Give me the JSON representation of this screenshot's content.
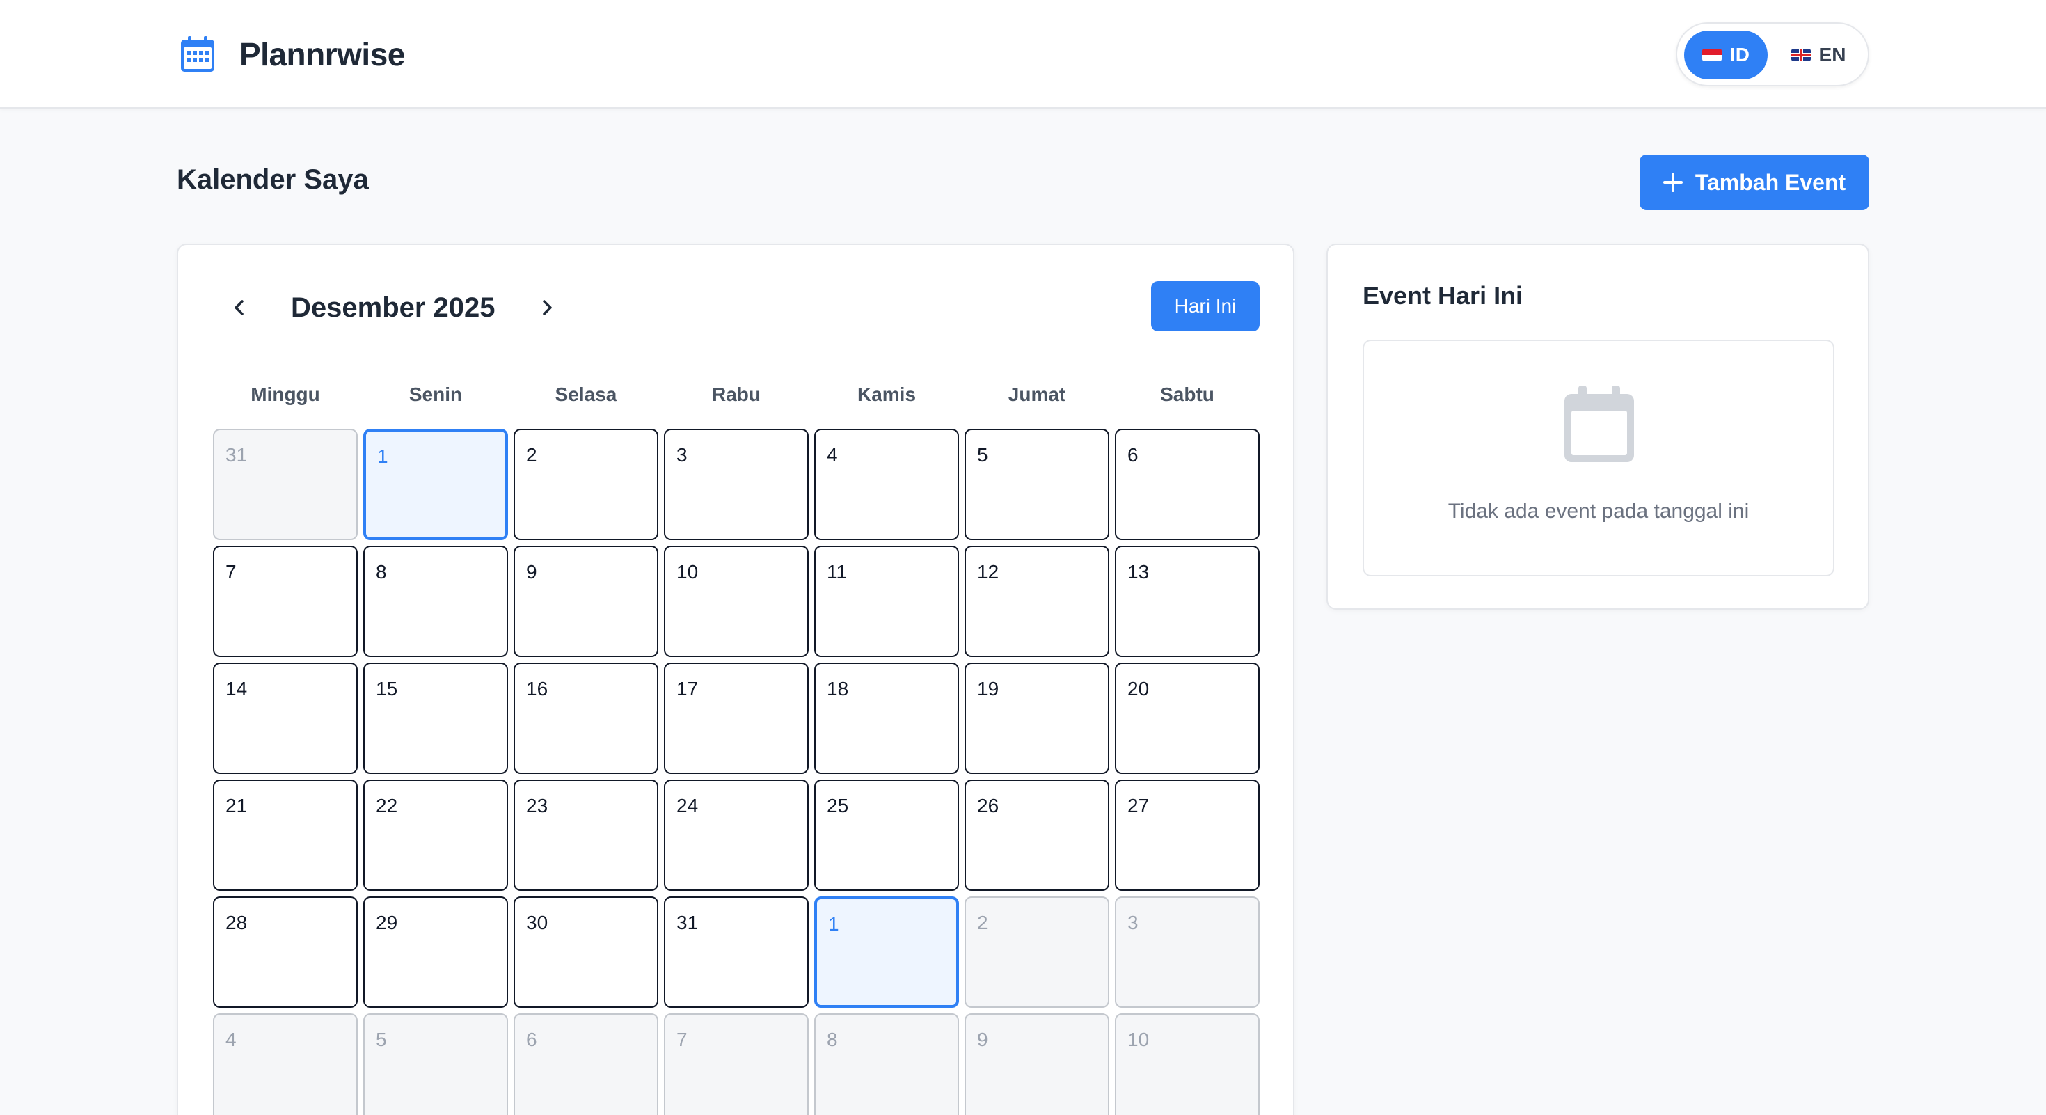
{
  "app": {
    "name": "Plannrwise",
    "brand_color": "#2f80f5"
  },
  "language": {
    "options": [
      {
        "code": "ID",
        "flag": "flag-id-icon",
        "active": true
      },
      {
        "code": "EN",
        "flag": "flag-uk-icon",
        "active": false
      }
    ]
  },
  "page": {
    "title": "Kalender Saya",
    "add_event_label": "Tambah Event"
  },
  "calendar": {
    "month_label": "Desember 2025",
    "today_label": "Hari Ini",
    "weekdays": [
      "Minggu",
      "Senin",
      "Selasa",
      "Rabu",
      "Kamis",
      "Jumat",
      "Sabtu"
    ],
    "days": [
      {
        "label": "31",
        "state": "other"
      },
      {
        "label": "1",
        "state": "selected"
      },
      {
        "label": "2",
        "state": "current"
      },
      {
        "label": "3",
        "state": "current"
      },
      {
        "label": "4",
        "state": "current"
      },
      {
        "label": "5",
        "state": "current"
      },
      {
        "label": "6",
        "state": "current"
      },
      {
        "label": "7",
        "state": "current"
      },
      {
        "label": "8",
        "state": "current"
      },
      {
        "label": "9",
        "state": "current"
      },
      {
        "label": "10",
        "state": "current"
      },
      {
        "label": "11",
        "state": "current"
      },
      {
        "label": "12",
        "state": "current"
      },
      {
        "label": "13",
        "state": "current"
      },
      {
        "label": "14",
        "state": "current"
      },
      {
        "label": "15",
        "state": "current"
      },
      {
        "label": "16",
        "state": "current"
      },
      {
        "label": "17",
        "state": "current"
      },
      {
        "label": "18",
        "state": "current"
      },
      {
        "label": "19",
        "state": "current"
      },
      {
        "label": "20",
        "state": "current"
      },
      {
        "label": "21",
        "state": "current"
      },
      {
        "label": "22",
        "state": "current"
      },
      {
        "label": "23",
        "state": "current"
      },
      {
        "label": "24",
        "state": "current"
      },
      {
        "label": "25",
        "state": "current"
      },
      {
        "label": "26",
        "state": "current"
      },
      {
        "label": "27",
        "state": "current"
      },
      {
        "label": "28",
        "state": "current"
      },
      {
        "label": "29",
        "state": "current"
      },
      {
        "label": "30",
        "state": "current"
      },
      {
        "label": "31",
        "state": "current"
      },
      {
        "label": "1",
        "state": "selected"
      },
      {
        "label": "2",
        "state": "other"
      },
      {
        "label": "3",
        "state": "other"
      },
      {
        "label": "4",
        "state": "other"
      },
      {
        "label": "5",
        "state": "other"
      },
      {
        "label": "6",
        "state": "other"
      },
      {
        "label": "7",
        "state": "other"
      },
      {
        "label": "8",
        "state": "other"
      },
      {
        "label": "9",
        "state": "other"
      },
      {
        "label": "10",
        "state": "other"
      }
    ]
  },
  "events": {
    "title": "Event Hari Ini",
    "empty_text": "Tidak ada event pada tanggal ini",
    "empty_icon": "calendar-icon"
  }
}
